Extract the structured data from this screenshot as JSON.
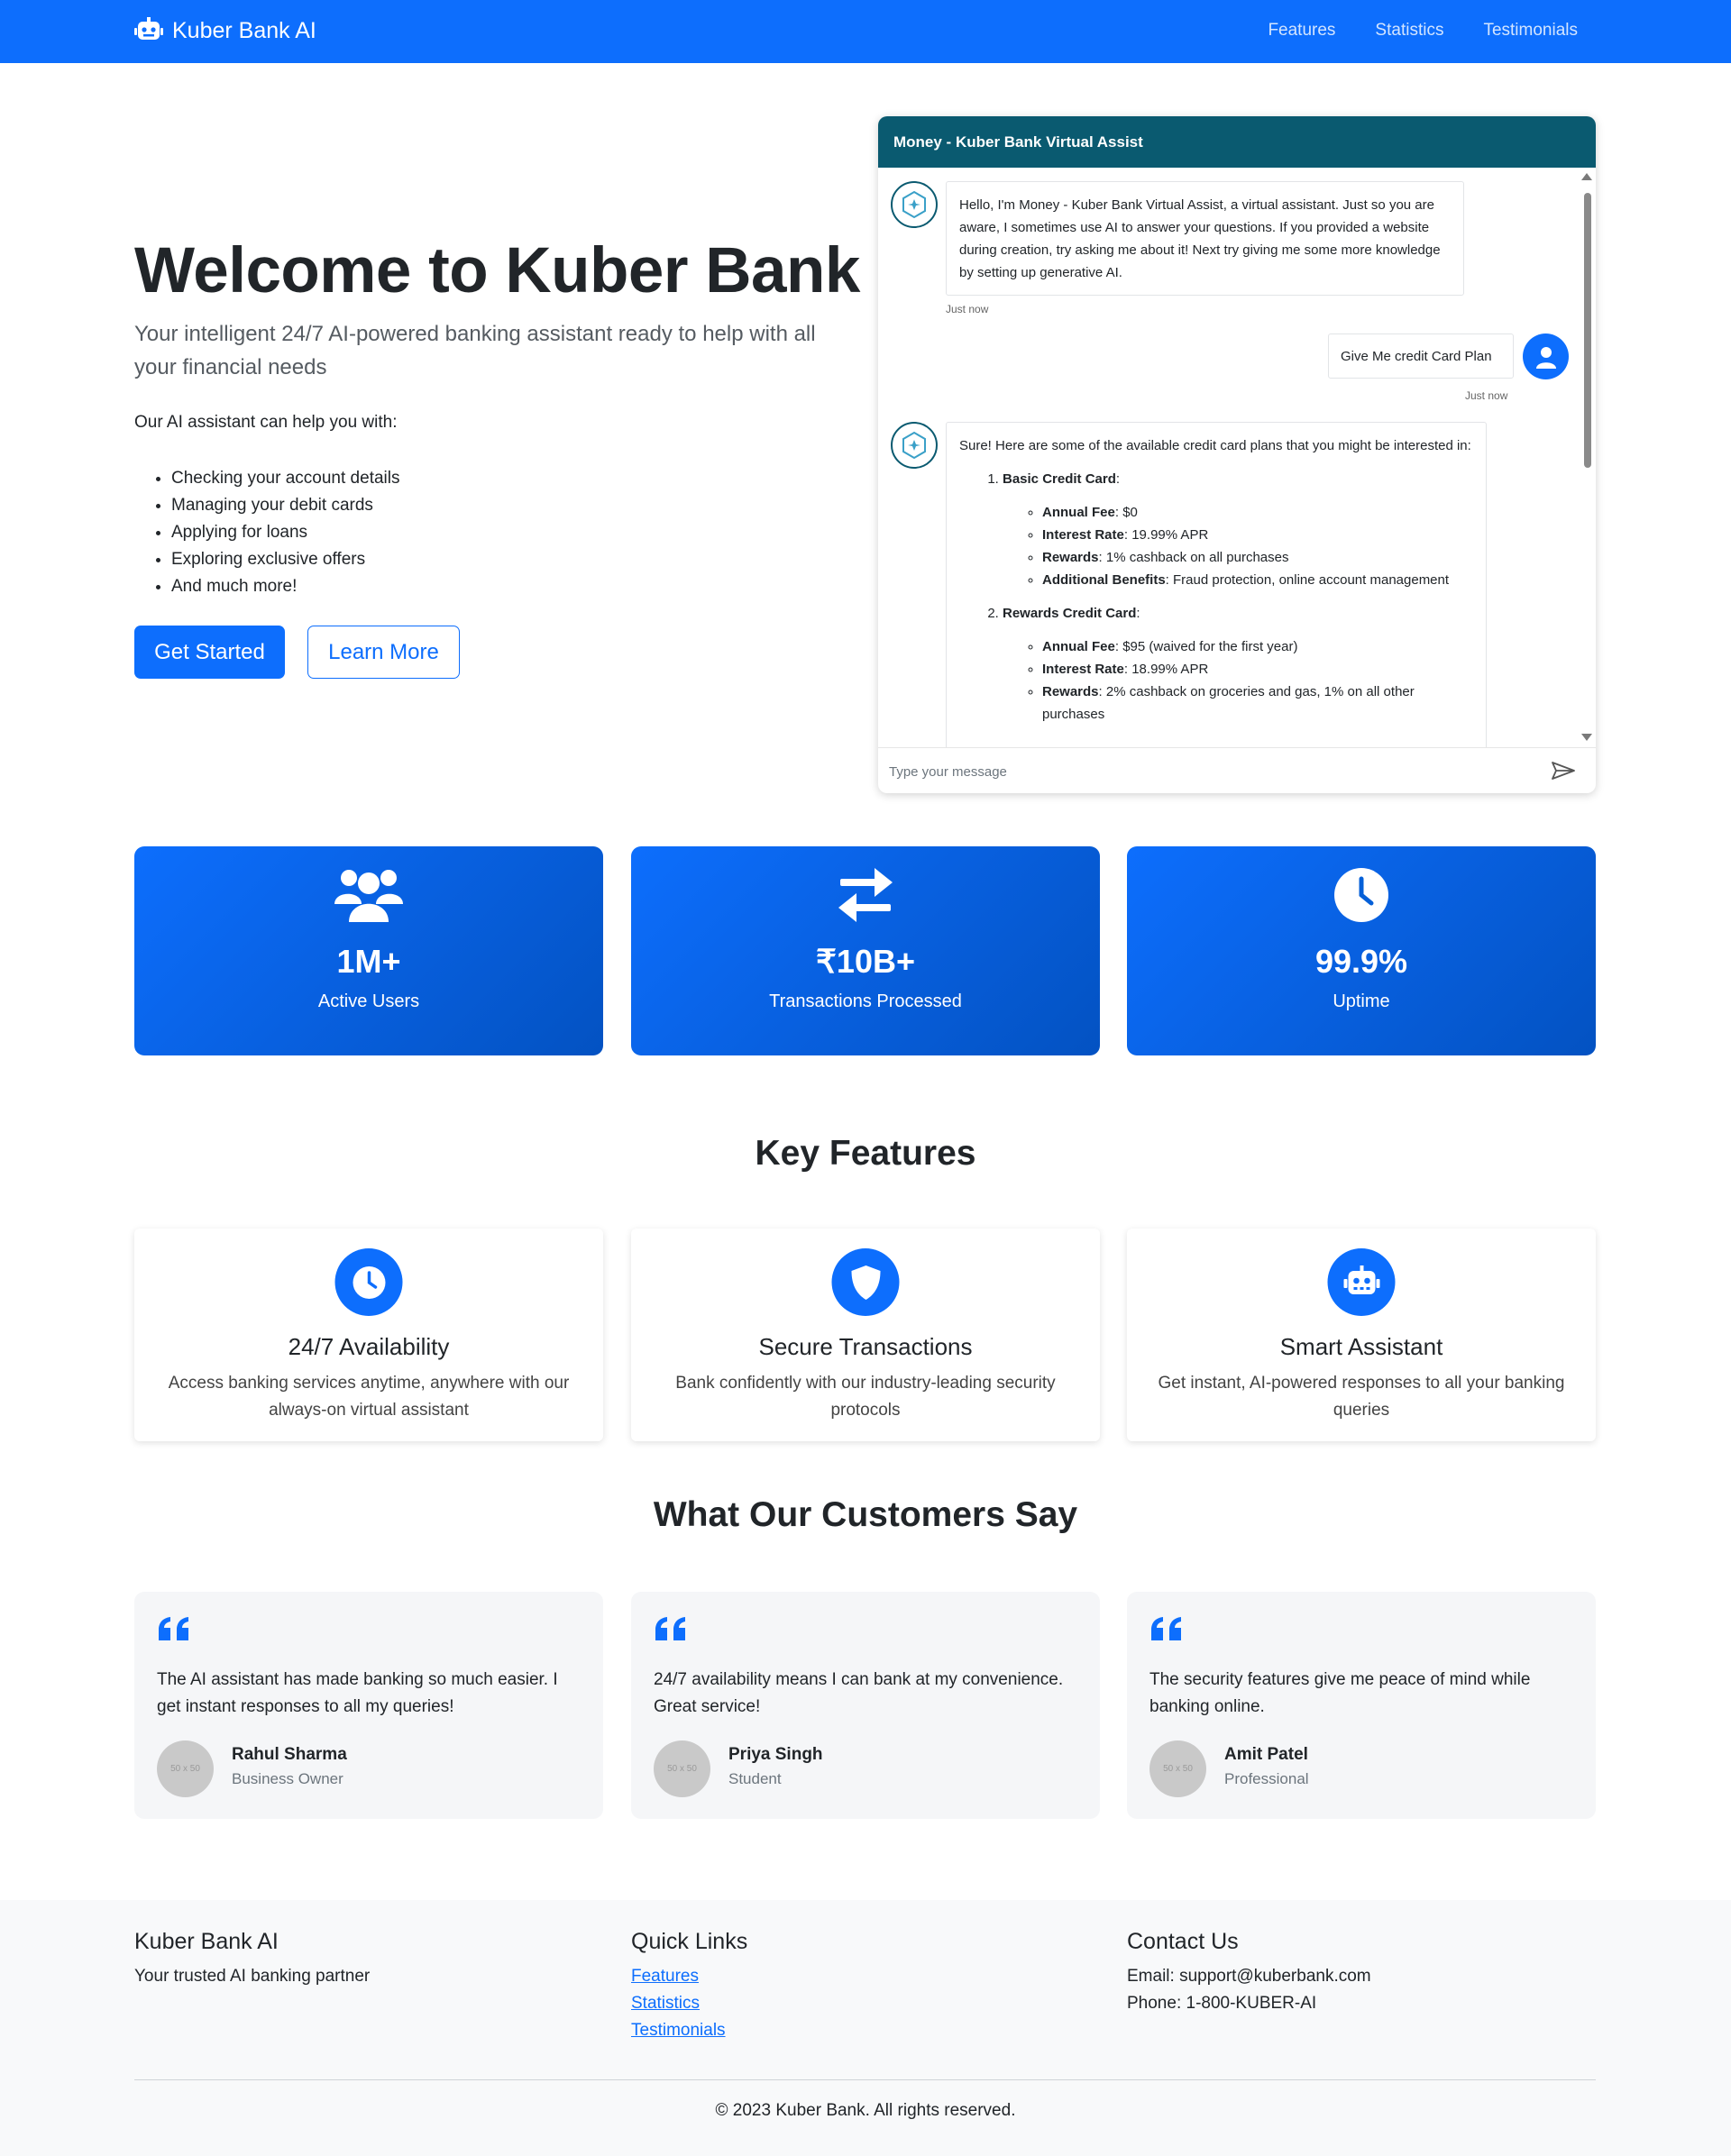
{
  "nav": {
    "brand": "Kuber Bank AI",
    "links": [
      "Features",
      "Statistics",
      "Testimonials"
    ]
  },
  "hero": {
    "title": "Welcome to Kuber Bank",
    "subtitle": "Your intelligent 24/7 AI-powered banking assistant ready to help with all your financial needs",
    "intro": "Our AI assistant can help you with:",
    "items": [
      "Checking your account details",
      "Managing your debit cards",
      "Applying for loans",
      "Exploring exclusive offers",
      "And much more!"
    ],
    "primary_btn": "Get Started",
    "secondary_btn": "Learn More"
  },
  "chat": {
    "title": "Money - Kuber Bank Virtual Assist",
    "bot_greeting": "Hello, I'm Money - Kuber Bank Virtual Assist, a virtual assistant. Just so you are aware, I sometimes use AI to answer your questions. If you provided a website during creation, try asking me about it! Next try giving me some more knowledge by setting up generative AI.",
    "greeting_time": "Just now",
    "user_message": "Give Me credit Card Plan",
    "user_time": "Just now",
    "bot_reply_intro": "Sure! Here are some of the available credit card plans that you might be interested in:",
    "plans": [
      {
        "name": "Basic Credit Card",
        "details": [
          {
            "label": "Annual Fee",
            "value": "$0"
          },
          {
            "label": "Interest Rate",
            "value": "19.99% APR"
          },
          {
            "label": "Rewards",
            "value": "1% cashback on all purchases"
          },
          {
            "label": "Additional Benefits",
            "value": "Fraud protection, online account management"
          }
        ]
      },
      {
        "name": "Rewards Credit Card",
        "details": [
          {
            "label": "Annual Fee",
            "value": "$95 (waived for the first year)"
          },
          {
            "label": "Interest Rate",
            "value": "18.99% APR"
          },
          {
            "label": "Rewards",
            "value": "2% cashback on groceries and gas, 1% on all other purchases"
          }
        ]
      }
    ],
    "input_placeholder": "Type your message"
  },
  "stats": [
    {
      "icon": "users-icon",
      "value": "1M+",
      "label": "Active Users"
    },
    {
      "icon": "exchange-arrows-icon",
      "value": "₹10B+",
      "label": "Transactions Processed"
    },
    {
      "icon": "clock-icon",
      "value": "99.9%",
      "label": "Uptime"
    }
  ],
  "features": {
    "title": "Key Features",
    "items": [
      {
        "icon": "clock-icon",
        "title": "24/7 Availability",
        "desc": "Access banking services anytime, anywhere with our always-on virtual assistant"
      },
      {
        "icon": "shield-icon",
        "title": "Secure Transactions",
        "desc": "Bank confidently with our industry-leading security protocols"
      },
      {
        "icon": "robot-icon",
        "title": "Smart Assistant",
        "desc": "Get instant, AI-powered responses to all your banking queries"
      }
    ]
  },
  "testimonials": {
    "title": "What Our Customers Say",
    "items": [
      {
        "text": "The AI assistant has made banking so much easier. I get instant responses to all my queries!",
        "avatar": "50 x 50",
        "name": "Rahul Sharma",
        "role": "Business Owner"
      },
      {
        "text": "24/7 availability means I can bank at my convenience. Great service!",
        "avatar": "50 x 50",
        "name": "Priya Singh",
        "role": "Student"
      },
      {
        "text": "The security features give me peace of mind while banking online.",
        "avatar": "50 x 50",
        "name": "Amit Patel",
        "role": "Professional"
      }
    ]
  },
  "footer": {
    "col1_title": "Kuber Bank AI",
    "col1_text": "Your trusted AI banking partner",
    "col2_title": "Quick Links",
    "links": [
      "Features",
      "Statistics",
      "Testimonials"
    ],
    "col3_title": "Contact Us",
    "email": "Email: support@kuberbank.com",
    "phone": "Phone: 1-800-KUBER-AI",
    "copyright": "© 2023 Kuber Bank. All rights reserved."
  },
  "colors": {
    "primary": "#0d6efd",
    "chat_header": "#0a5a70",
    "footer_bg": "#f8f9fa"
  }
}
